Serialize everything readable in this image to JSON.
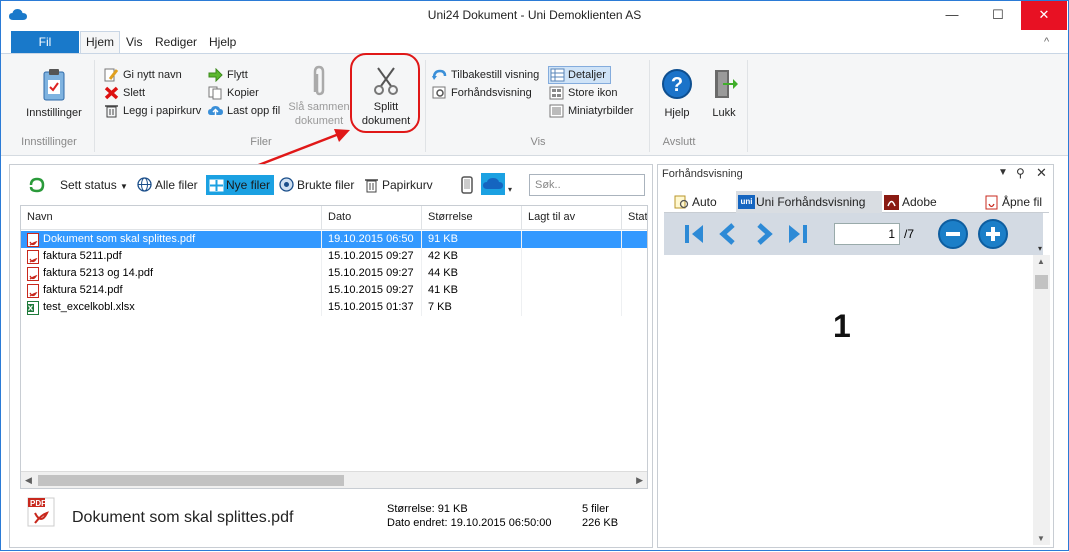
{
  "window": {
    "title": "Uni24 Dokument - Uni Demoklienten AS",
    "min": "—",
    "max": "☐",
    "close": "✕",
    "collapse": "^"
  },
  "tabs": [
    {
      "label": "Fil"
    },
    {
      "label": "Hjem"
    },
    {
      "label": "Vis"
    },
    {
      "label": "Rediger"
    },
    {
      "label": "Hjelp"
    }
  ],
  "ribbon": {
    "innstillinger": {
      "button": "Innstillinger",
      "group": "Innstillinger"
    },
    "filer": {
      "gi_nytt_navn": "Gi nytt navn",
      "slett": "Slett",
      "legg_i_papirkurv": "Legg i papirkurv",
      "flytt": "Flytt",
      "kopier": "Kopier",
      "last_opp_fil": "Last opp fil",
      "sla_sammen_1": "Slå sammen",
      "sla_sammen_2": "dokument",
      "splitt_1": "Splitt",
      "splitt_2": "dokument",
      "group": "Filer"
    },
    "vis": {
      "tilbakestill": "Tilbakestill visning",
      "forhandsvisning": "Forhåndsvisning",
      "detaljer": "Detaljer",
      "store_ikon": "Store ikon",
      "miniatyrbilder": "Miniatyrbilder",
      "group": "Vis"
    },
    "avslutt": {
      "hjelp": "Hjelp",
      "lukk": "Lukk",
      "group": "Avslutt"
    }
  },
  "toolbar": {
    "sett_status": "Sett status",
    "alle_filer": "Alle filer",
    "nye_filer": "Nye filer",
    "brukte_filer": "Brukte filer",
    "papirkurv": "Papirkurv",
    "search_placeholder": "Søk.."
  },
  "filelist": {
    "columns": [
      "Navn",
      "Dato",
      "Størrelse",
      "Lagt til av",
      "Stat"
    ],
    "rows": [
      {
        "name": "Dokument som skal splittes.pdf",
        "date": "19.10.2015 06:50",
        "size": "91 KB",
        "type": "pdf",
        "selected": true
      },
      {
        "name": "faktura 5211.pdf",
        "date": "15.10.2015 09:27",
        "size": "42 KB",
        "type": "pdf",
        "selected": false
      },
      {
        "name": "faktura 5213 og 14.pdf",
        "date": "15.10.2015 09:27",
        "size": "44 KB",
        "type": "pdf",
        "selected": false
      },
      {
        "name": "faktura 5214.pdf",
        "date": "15.10.2015 09:27",
        "size": "41 KB",
        "type": "pdf",
        "selected": false
      },
      {
        "name": "test_excelkobl.xlsx",
        "date": "15.10.2015 01:37",
        "size": "7 KB",
        "type": "xlsx",
        "selected": false
      }
    ]
  },
  "status": {
    "icon_label": "PDF",
    "filename": "Dokument som skal splittes.pdf",
    "storrelse": "Størrelse: 91 KB",
    "dato_endret": "Dato endret: 19.10.2015 06:50:00",
    "file_count": "5 filer",
    "total_size": "226 KB"
  },
  "preview": {
    "title": "Forhåndsvisning",
    "tabs": [
      {
        "label": "Auto"
      },
      {
        "label": "Uni Forhåndsvisning"
      },
      {
        "label": "Adobe"
      },
      {
        "label": "Åpne fil"
      }
    ],
    "uni_badge": "uni",
    "page_current": "1",
    "page_total": "/7",
    "page_display": "1"
  },
  "colors": {
    "accent": "#1979ca",
    "selection": "#3399ff",
    "highlight": "#e01818"
  }
}
